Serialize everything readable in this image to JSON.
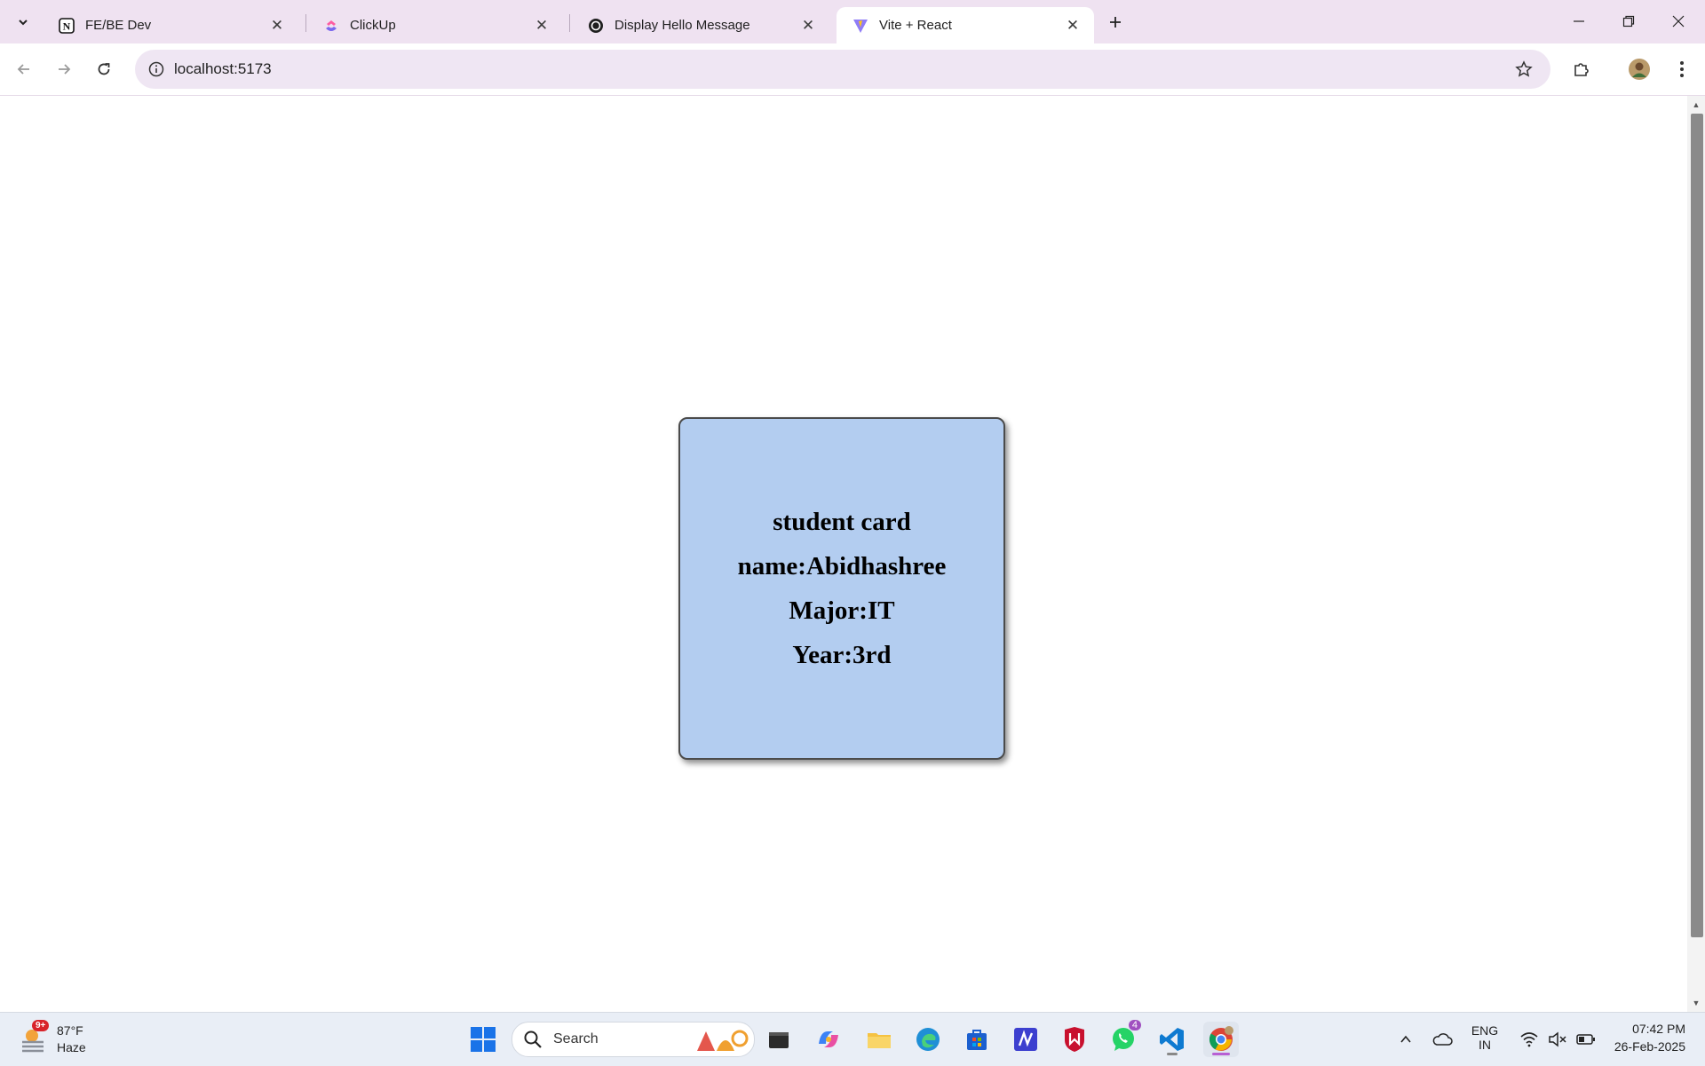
{
  "browser": {
    "tabs": [
      {
        "title": "FE/BE Dev",
        "icon": "notion-icon",
        "active": false
      },
      {
        "title": "ClickUp",
        "icon": "clickup-icon",
        "active": false
      },
      {
        "title": "Display Hello Message",
        "icon": "chatgpt-icon",
        "active": false
      },
      {
        "title": "Vite + React",
        "icon": "vite-icon",
        "active": true
      }
    ],
    "address": "localhost:5173"
  },
  "card": {
    "title": "student card",
    "name": "name:Abidhashree",
    "major": "Major:IT",
    "year": "Year:3rd",
    "background": "#b3cdf0"
  },
  "taskbar": {
    "weather": {
      "badge": "9+",
      "temp": "87°F",
      "condition": "Haze"
    },
    "search_label": "Search",
    "whatsapp_badge": "4",
    "lang_top": "ENG",
    "lang_bottom": "IN",
    "time": "07:42 PM",
    "date": "26-Feb-2025"
  }
}
